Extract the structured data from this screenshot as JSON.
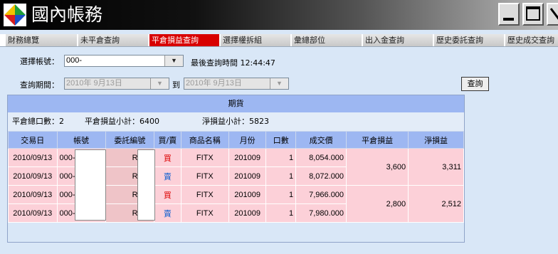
{
  "app": {
    "title": "國內帳務"
  },
  "window_controls": [
    "minimize-icon",
    "maximize-icon",
    "close-icon"
  ],
  "colors": {
    "active_tab": "#d80000",
    "header_bg": "#9db7f2",
    "row_bg": "#fcd0d8",
    "buy": "#d00000",
    "sell": "#1060d0"
  },
  "tabs": [
    {
      "label": "財務總覽"
    },
    {
      "label": "未平倉查詢"
    },
    {
      "label": "平倉損益查詢",
      "active": true
    },
    {
      "label": "選擇權拆組"
    },
    {
      "label": "彙總部位"
    },
    {
      "label": "出入金查詢"
    },
    {
      "label": "歷史委託查詢"
    },
    {
      "label": "歷史成交查詢"
    }
  ],
  "form": {
    "account_label": "選擇帳號：",
    "account_value": "000-",
    "last_query_label": "最後查詢時間 12:44:47",
    "period_label": "查詢期間：",
    "date_from": "2010年  9月13日",
    "to_label": "到",
    "date_to": "2010年  9月13日",
    "query_button": "查詢"
  },
  "panel": {
    "title": "期貨",
    "summary": {
      "total_lots": "平倉總口數：2",
      "pnl_subtotal": "平倉損益小計：6400",
      "net_subtotal": "淨損益小計：5823"
    },
    "columns": [
      "交易日",
      "帳號",
      "委託編號",
      "買/賣",
      "商品名稱",
      "月份",
      "口數",
      "成交價",
      "平倉損益",
      "淨損益"
    ],
    "rows": [
      {
        "date": "2010/09/13",
        "account": "000-",
        "order": "RA67",
        "side": "買",
        "product": "FITX",
        "month": "201009",
        "qty": "1",
        "price": "8,054.000"
      },
      {
        "date": "2010/09/13",
        "account": "000-",
        "order": "RA68",
        "side": "賣",
        "product": "FITX",
        "month": "201009",
        "qty": "1",
        "price": "8,072.000"
      },
      {
        "date": "2010/09/13",
        "account": "000-",
        "order": "RA18",
        "side": "買",
        "product": "FITX",
        "month": "201009",
        "qty": "1",
        "price": "7,966.000"
      },
      {
        "date": "2010/09/13",
        "account": "000-",
        "order": "RA22",
        "side": "賣",
        "product": "FITX",
        "month": "201009",
        "qty": "1",
        "price": "7,980.000"
      }
    ],
    "groups": [
      {
        "pnl": "3,600",
        "net": "3,311"
      },
      {
        "pnl": "2,800",
        "net": "2,512"
      }
    ]
  }
}
